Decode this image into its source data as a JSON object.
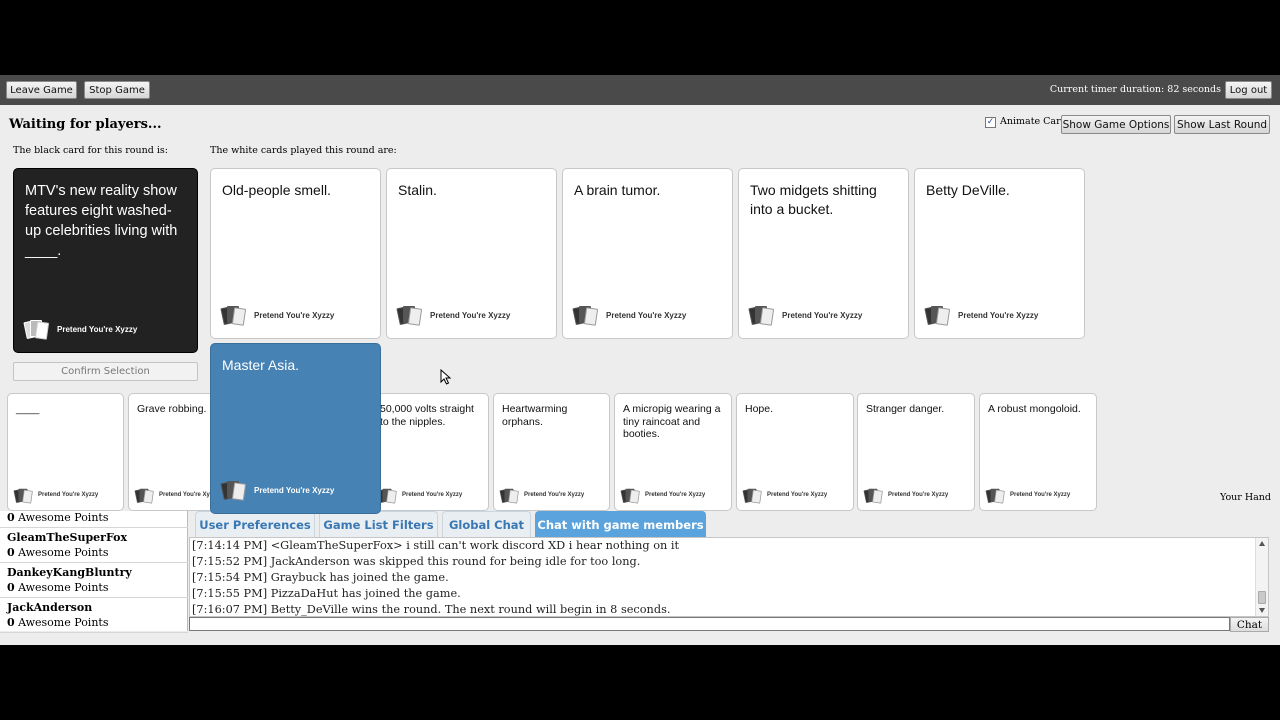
{
  "topbar": {
    "leave_game": "Leave Game",
    "stop_game": "Stop Game",
    "timer_text": "Current timer duration: 82 seconds",
    "log_out": "Log out"
  },
  "status": {
    "title": "Waiting for players...",
    "animate_cards_label": "Animate Cards",
    "animate_cards_checked": true,
    "show_game_options": "Show Game Options",
    "show_last_round": "Show Last Round"
  },
  "black_card": {
    "section_label": "The black card for this round is:",
    "text": "MTV's new reality show features eight washed-up celebrities living with ____.",
    "footer": "Pretend You're Xyzzy",
    "confirm_selection": "Confirm Selection"
  },
  "played_cards": {
    "section_label": "The white cards played this round are:",
    "cards": [
      {
        "text": "Old-people smell.",
        "footer": "Pretend You're Xyzzy"
      },
      {
        "text": "Stalin.",
        "footer": "Pretend You're Xyzzy"
      },
      {
        "text": "A brain tumor.",
        "footer": "Pretend You're Xyzzy"
      },
      {
        "text": "Two midgets shitting into a bucket.",
        "footer": "Pretend You're Xyzzy"
      },
      {
        "text": "Betty DeVille.",
        "footer": "Pretend You're Xyzzy"
      }
    ],
    "winning_card": {
      "text": "Master Asia.",
      "footer": "Pretend You're Xyzzy"
    }
  },
  "hand": {
    "label": "Your Hand",
    "cards": [
      {
        "text": "____",
        "footer": "Pretend You're Xyzzy"
      },
      {
        "text": "Grave robbing.",
        "footer": "Pretend You're Xyzzy"
      },
      {
        "text": "",
        "footer": ""
      },
      {
        "text": "50,000 volts straight to the nipples.",
        "footer": "Pretend You're Xyzzy"
      },
      {
        "text": "Heartwarming orphans.",
        "footer": "Pretend You're Xyzzy"
      },
      {
        "text": "A micropig wearing a tiny raincoat and booties.",
        "footer": "Pretend You're Xyzzy"
      },
      {
        "text": "Hope.",
        "footer": "Pretend You're Xyzzy"
      },
      {
        "text": "Stranger danger.",
        "footer": "Pretend You're Xyzzy"
      },
      {
        "text": "A robust mongoloid.",
        "footer": "Pretend You're Xyzzy"
      }
    ]
  },
  "scoreboard": {
    "rows": [
      {
        "name": "",
        "points": "0",
        "points_label": " Awesome Points"
      },
      {
        "name": "GleamTheSuperFox",
        "points": "0",
        "points_label": " Awesome Points"
      },
      {
        "name": "DankeyKangBluntry",
        "points": "0",
        "points_label": " Awesome Points"
      },
      {
        "name": "JackAnderson",
        "points": "0",
        "points_label": " Awesome Points"
      }
    ]
  },
  "tabs": [
    {
      "label": "User Preferences",
      "active": false
    },
    {
      "label": "Game List Filters",
      "active": false
    },
    {
      "label": "Global Chat",
      "active": false
    },
    {
      "label": "Chat with game members",
      "active": true
    }
  ],
  "chat": {
    "lines": [
      "[7:14:14 PM] <GleamTheSuperFox> i still can't work discord XD i hear nothing on it",
      "[7:15:52 PM] JackAnderson was skipped this round for being idle for too long.",
      "[7:15:54 PM] Graybuck has joined the game.",
      "[7:15:55 PM] PizzaDaHut has joined the game.",
      "[7:16:07 PM] Betty_DeVille wins the round. The next round will begin in 8 seconds."
    ],
    "input_value": "",
    "send_label": "Chat"
  },
  "colors": {
    "topbar": "#4a4a4a",
    "background": "#ededed",
    "black_card": "#222222",
    "selected_card": "#4682b4",
    "active_tab": "#5ba3dc",
    "tab_text": "#3a78b4"
  },
  "icons": [
    "card-deck-logo-icon",
    "checkbox-check-icon",
    "scroll-up-icon",
    "scroll-down-icon",
    "mouse-cursor-icon"
  ]
}
